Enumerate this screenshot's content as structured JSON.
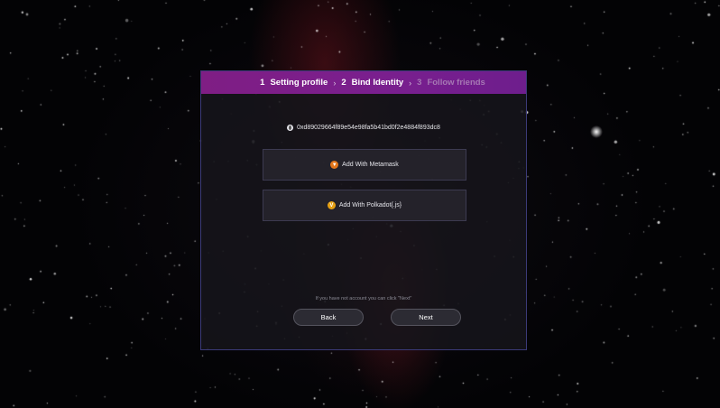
{
  "stepper": {
    "steps": [
      {
        "num": "1",
        "label": "Setting profile"
      },
      {
        "num": "2",
        "label": "Bind Identity"
      },
      {
        "num": "3",
        "label": "Follow friends"
      }
    ],
    "separator": "›"
  },
  "identity": {
    "address": "0xd89029664f89e54e98fa5b41bd0f2e4884f893dc8"
  },
  "actions": {
    "metamask_label": "Add With Metamask",
    "polkadot_label": "Add With Polkadot{.js}"
  },
  "footer": {
    "hint": "If you have not account you can click \"Next\"",
    "back_label": "Back",
    "next_label": "Next"
  },
  "icons": {
    "address": "wallet-icon",
    "metamask": "metamask-fox-icon",
    "polkadot": "polkadot-icon"
  },
  "colors": {
    "header_gradient_start": "#7f1e84",
    "header_gradient_end": "#6e1e8d",
    "dialog_border": "#3b3a78",
    "inactive_step": "#a678b4"
  }
}
